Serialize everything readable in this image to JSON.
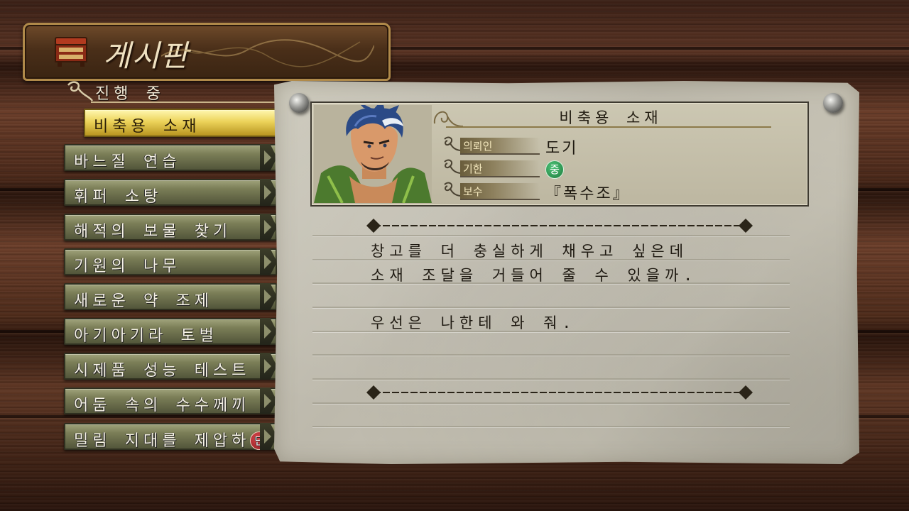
{
  "board_title": "게시판",
  "status_header": "진행 중",
  "quests": [
    {
      "label": "비축용 소재",
      "selected": true
    },
    {
      "label": "바느질 연습",
      "selected": false
    },
    {
      "label": "휘퍼 소탕",
      "selected": false
    },
    {
      "label": "해적의 보물 찾기",
      "selected": false
    },
    {
      "label": "기원의 나무",
      "selected": false
    },
    {
      "label": "새로운 약 조제",
      "selected": false
    },
    {
      "label": "아기아기라 토벌",
      "selected": false
    },
    {
      "label": "시제품 성능 테스트",
      "selected": false
    },
    {
      "label": "어둠 속의 수수께끼",
      "selected": false
    },
    {
      "label": "밀림 지대를 제압하",
      "badge": "단",
      "selected": false
    }
  ],
  "detail": {
    "title": "비축용 소재",
    "client_label": "의뢰인",
    "client_value": "도기",
    "deadline_label": "기한",
    "deadline_value": "중",
    "reward_label": "보수",
    "reward_value": "『폭수조』",
    "description": [
      "창고를 더 충실하게 채우고 싶은데",
      "소재 조달을 거들어 줄 수 있을까.",
      "우선은 나한테 와 줘."
    ]
  },
  "colors": {
    "selected_gold": "#ecd35a",
    "quest_olive": "#7b7e57",
    "deadline_green": "#1d7a3c",
    "badge_red": "#8a1b20"
  }
}
